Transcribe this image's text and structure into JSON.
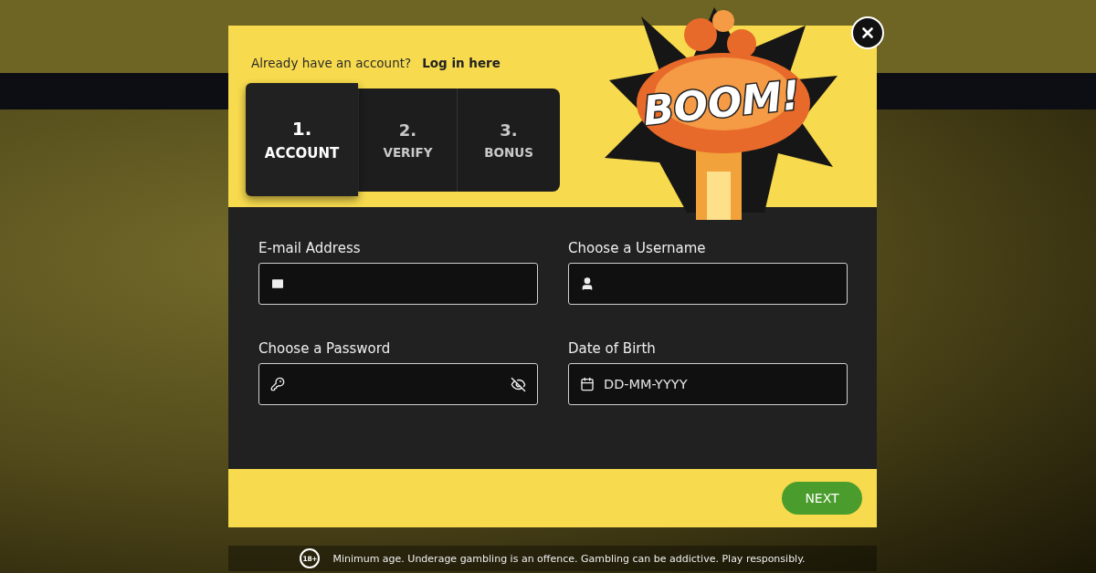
{
  "modal": {
    "login_prompt": "Already have an account?",
    "login_link": "Log in here",
    "steps": [
      {
        "number": "1.",
        "label": "ACCOUNT",
        "selected": true
      },
      {
        "number": "2.",
        "label": "VERIFY",
        "selected": false
      },
      {
        "number": "3.",
        "label": "BONUS",
        "selected": false
      }
    ],
    "artwork_text": "BOOM!",
    "fields": [
      {
        "kind": "email",
        "label": "E-mail Address"
      },
      {
        "kind": "username",
        "label": "Choose a Username"
      },
      {
        "kind": "password",
        "label": "Choose a Password"
      },
      {
        "kind": "date",
        "label": "Date of Birth",
        "placeholder": "DD-MM-YYYY"
      }
    ],
    "next_button": "NEXT"
  },
  "disclaimer": {
    "badge": "18+",
    "text": "Minimum age. Underage gambling is an offence. Gambling can be addictive. Play responsibly."
  }
}
